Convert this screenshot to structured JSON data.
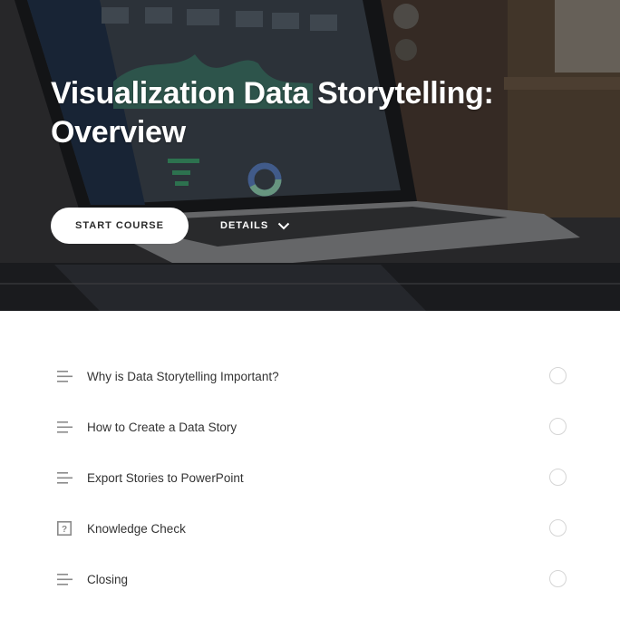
{
  "course": {
    "title": "Visualization Data Storytelling: Overview"
  },
  "actions": {
    "start_label": "START COURSE",
    "details_label": "DETAILS"
  },
  "lessons": [
    {
      "title": "Why is Data Storytelling Important?",
      "icon": "text-lines-icon"
    },
    {
      "title": "How to Create a Data Story",
      "icon": "text-lines-icon"
    },
    {
      "title": "Export Stories to PowerPoint",
      "icon": "text-lines-icon"
    },
    {
      "title": "Knowledge Check",
      "icon": "question-box-icon"
    },
    {
      "title": "Closing",
      "icon": "text-lines-icon"
    }
  ],
  "colors": {
    "hero_overlay": "#2c2d30",
    "button_bg": "#ffffff",
    "text": "#333333",
    "icon": "#8a8a8a",
    "status_ring": "#d5d5d5"
  }
}
